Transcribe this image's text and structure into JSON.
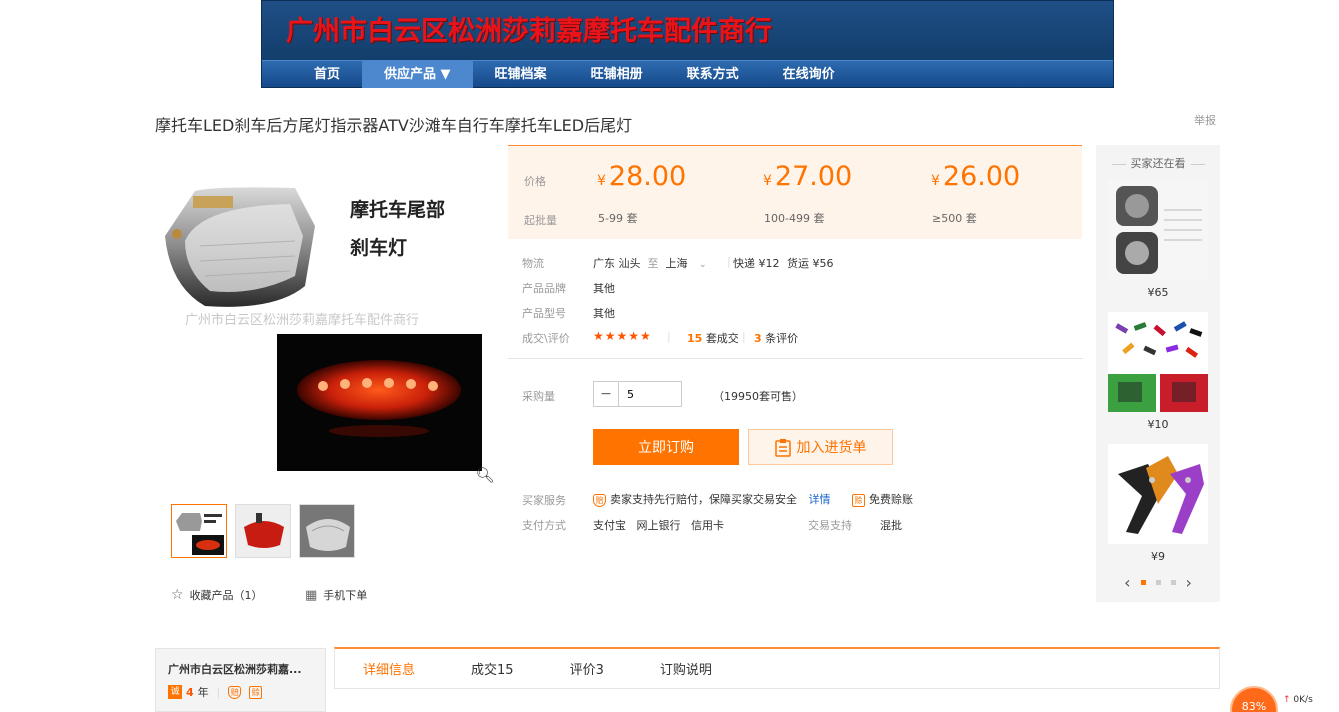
{
  "shop": {
    "name": "广州市白云区松洲莎莉嘉摩托车配件商行",
    "nav": [
      "首页",
      "供应产品 ▼",
      "旺铺档案",
      "旺铺相册",
      "联系方式",
      "在线询价"
    ]
  },
  "product": {
    "title": "摩托车LED刹车后方尾灯指示器ATV沙滩车自行车摩托车LED后尾灯",
    "report": "举报",
    "image_caption_line1": "摩托车尾部",
    "image_caption_line2": "刹车灯",
    "watermark": "广州市白云区松洲莎莉嘉摩托车配件商行",
    "favorite": "收藏产品（1）",
    "mobile_order": "手机下单"
  },
  "price": {
    "price_label": "价格",
    "min_label": "起批量",
    "currency": "¥",
    "tiers": [
      {
        "price": "28.00",
        "qty": "5-99 套"
      },
      {
        "price": "27.00",
        "qty": "100-499 套"
      },
      {
        "price": "26.00",
        "qty": "≥500 套"
      }
    ]
  },
  "attrs": {
    "logistics_label": "物流",
    "from": "广东 汕头",
    "to_word": "至",
    "to": "上海",
    "express": "快递 ¥12",
    "freight": "货运 ¥56",
    "brand_label": "产品品牌",
    "brand": "其他",
    "model_label": "产品型号",
    "model": "其他",
    "deal_label": "成交\\评价",
    "stars": "★★★★★",
    "deals_num": "15",
    "deals_text": "套成交",
    "reviews_num": "3",
    "reviews_text": "条评价"
  },
  "purchase": {
    "qty_label": "采购量",
    "qty_value": "5",
    "available": "（19950套可售）",
    "buy_now": "立即订购",
    "add_cart": "加入进货单"
  },
  "service": {
    "buyer_label": "买家服务",
    "buyer_text": "卖家支持先行赔付，保障买家交易安全",
    "detail_link": "详情",
    "free": "免费赊账",
    "pay_label": "支付方式",
    "pay_methods": "支付宝   网上银行   信用卡",
    "trade_label": "交易支持",
    "trade_value": "混批"
  },
  "sidebar": {
    "title": "买家还在看",
    "items": [
      {
        "price": "¥65"
      },
      {
        "price": "¥10"
      },
      {
        "price": "¥9"
      }
    ]
  },
  "bottom": {
    "shop_short": "广州市白云区松洲莎莉嘉...",
    "years_badge": "诚",
    "years": "4",
    "years_unit": "年",
    "tabs": [
      "详细信息",
      "成交15",
      "评价3",
      "订购说明"
    ]
  },
  "status": {
    "speed": "83%",
    "net": "0K/s"
  },
  "colors": {
    "accent": "#ff7300",
    "banner": "#14406f",
    "shop_name": "#e8141a"
  }
}
